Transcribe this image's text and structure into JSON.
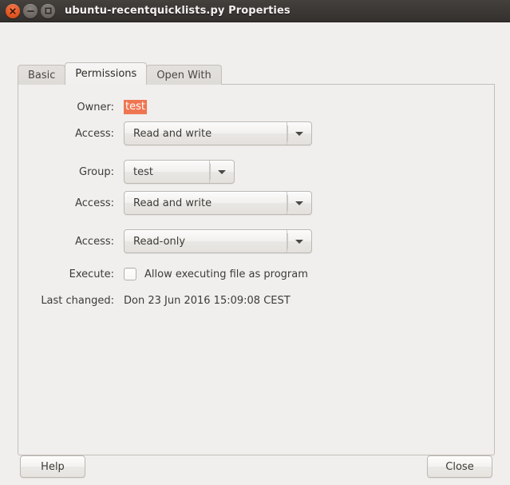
{
  "window": {
    "title": "ubuntu-recentquicklists.py Properties",
    "controls": [
      {
        "name": "close-window-button",
        "icon": "close-icon"
      },
      {
        "name": "minimize-window-button",
        "icon": "minimize-icon"
      },
      {
        "name": "maximize-window-button",
        "icon": "maximize-icon"
      }
    ]
  },
  "tabs": [
    {
      "label": "Basic",
      "active": false
    },
    {
      "label": "Permissions",
      "active": true
    },
    {
      "label": "Open With",
      "active": false
    }
  ],
  "permissions": {
    "owner": {
      "label": "Owner:",
      "value": "test",
      "selected": true
    },
    "owner_access": {
      "label": "Access:",
      "value": "Read and write"
    },
    "group": {
      "label": "Group:",
      "value": "test"
    },
    "group_access": {
      "label": "Access:",
      "value": "Read and write"
    },
    "others_access": {
      "label": "Access:",
      "value": "Read-only"
    },
    "execute": {
      "label": "Execute:",
      "checkbox_label": "Allow executing file as program",
      "checked": false
    },
    "last_changed": {
      "label": "Last changed:",
      "value": "Don 23 Jun 2016 15:09:08 CEST"
    }
  },
  "actions": {
    "help_label": "Help",
    "close_label": "Close"
  },
  "colors": {
    "titlebar": "#3b3835",
    "close_button": "#e2551f",
    "selection": "#ef7551",
    "dialog_background": "#f0efee",
    "border": "#c3bfba",
    "text": "#3c3b37"
  }
}
